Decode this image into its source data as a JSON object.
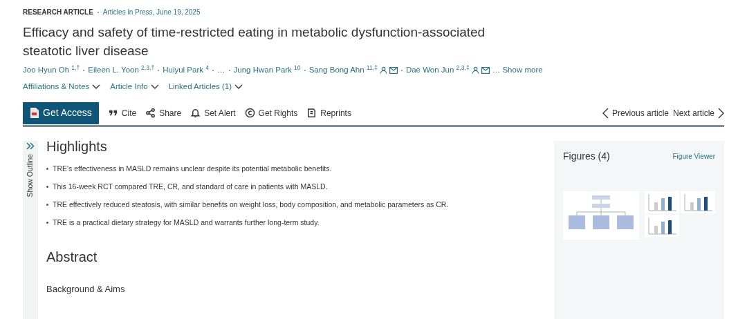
{
  "header": {
    "article_type": "RESEARCH ARTICLE",
    "status": "Articles in Press, June 19, 2025"
  },
  "title": "Efficacy and safety of time-restricted eating in metabolic dysfunction-associated steatotic liver disease",
  "authors": [
    {
      "name": "Joo Hyun Oh",
      "sup": "1,†",
      "corresponding": false
    },
    {
      "name": "Eileen L. Yoon",
      "sup": "2,3,†",
      "corresponding": false
    },
    {
      "name": "Huiyul Park",
      "sup": "4",
      "corresponding": false
    },
    {
      "name": "…",
      "corresponding": false
    },
    {
      "name": "Jung Hwan Park",
      "sup": "10",
      "corresponding": false
    },
    {
      "name": "Sang Bong Ahn",
      "sup": "11,‡",
      "corresponding": true
    },
    {
      "name": "Dae Won Jun",
      "sup": "2,3,‡",
      "corresponding": true
    }
  ],
  "show_more": "… Show more",
  "info_links": [
    "Affiliations & Notes",
    "Article Info",
    "Linked Articles (1)"
  ],
  "toolbar": {
    "primary": "Get Access",
    "actions": [
      {
        "kind": "cite",
        "label": "Cite"
      },
      {
        "kind": "share",
        "label": "Share"
      },
      {
        "kind": "alert",
        "label": "Set Alert"
      },
      {
        "kind": "rights",
        "label": "Get Rights"
      },
      {
        "kind": "reprints",
        "label": "Reprints"
      }
    ],
    "previous": "Previous article",
    "next": "Next article"
  },
  "outline": {
    "label": "Show Outline"
  },
  "highlights": {
    "heading": "Highlights",
    "items": [
      "TRE's effectiveness in MASLD remains unclear despite its potential metabolic benefits.",
      "This 16-week RCT compared TRE, CR, and standard of care in patients with MASLD.",
      "TRE effectively reduced steatosis, with similar benefits on weight loss, body composition, and metabolic parameters as CR.",
      "TRE is a practical dietary strategy for MASLD and warrants further long-term study."
    ]
  },
  "abstract": {
    "heading": "Abstract",
    "subheading": "Background & Aims"
  },
  "figures": {
    "title": "Figures (4)",
    "viewer": "Figure Viewer",
    "thumbnails": [
      {
        "kind": "flowchart"
      },
      {
        "kind": "bars"
      },
      {
        "kind": "bars"
      },
      {
        "kind": "bars"
      }
    ]
  }
}
